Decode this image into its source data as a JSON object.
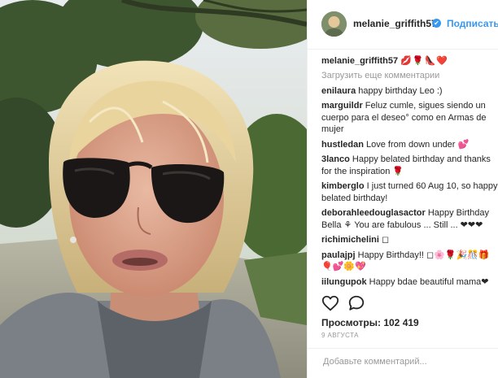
{
  "post": {
    "username": "melanie_griffith57",
    "follow_label": "Подписаться",
    "verified_glyph": "✔",
    "caption_emojis": "💋🌹👠❤️",
    "load_more": "Загрузить еще комментарии",
    "views": "Просмотры: 102 419",
    "date": "9 АВГУСТА",
    "add_comment_placeholder": "Добавьте комментарий..."
  },
  "comments": [
    {
      "user": "enilaura",
      "text": "happy birthday Leo :)"
    },
    {
      "user": "marguildr",
      "text": "Feluz cumle, sigues siendo un cuerpo para el deseo° como en Armas de mujer"
    },
    {
      "user": "hustledan",
      "text": "Love from down under 💕"
    },
    {
      "user": "3lanco",
      "text": "Happy belated birthday and thanks for the inspiration 🌹"
    },
    {
      "user": "kimberglo",
      "text": "I just turned 60 Aug 10, so happy belated birthday!"
    },
    {
      "user": "deborahleedouglasactor",
      "text": "Happy Birthday Bella ⚘ You are fabulous ... Still ... ❤❤❤"
    },
    {
      "user": "richimichelini",
      "text": "◻"
    },
    {
      "user": "paulajpj",
      "text": "Happy Birthday!! ◻🌸🌹🎉🎊🎁🎈💕🌼💖"
    },
    {
      "user": "iilungupok",
      "text": "Happy bdae beautiful mama❤"
    }
  ],
  "icons": {
    "heart": "heart-icon",
    "comment": "comment-bubble-icon",
    "verified": "verified-badge-icon"
  },
  "colors": {
    "accent_blue": "#3897f0",
    "muted_gray": "#999999",
    "text": "#262626"
  }
}
